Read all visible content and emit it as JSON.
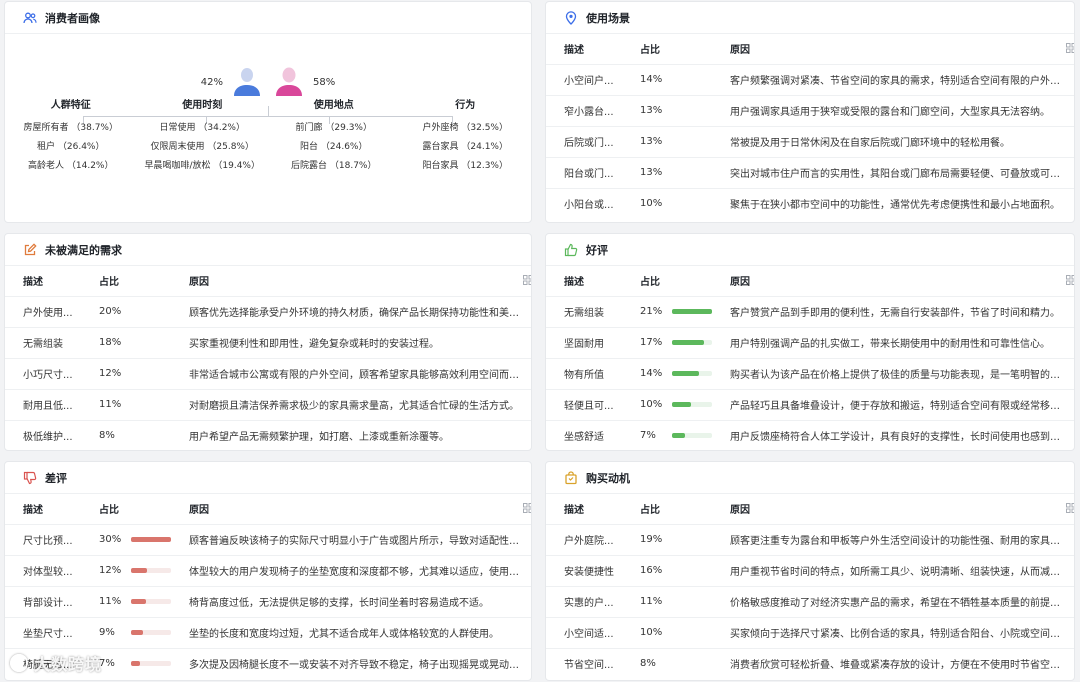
{
  "persona": {
    "title": "消费者画像",
    "male_pct": "42%",
    "female_pct": "58%",
    "groups": [
      {
        "title": "人群特征",
        "items": [
          "房屋所有者 （38.7%）",
          "租户 （26.4%）",
          "高龄老人 （14.2%）"
        ]
      },
      {
        "title": "使用时刻",
        "items": [
          "日常使用 （34.2%）",
          "仅限周末使用 （25.8%）",
          "早晨喝咖啡/放松 （19.4%）"
        ]
      },
      {
        "title": "使用地点",
        "items": [
          "前门廊 （29.3%）",
          "阳台 （24.6%）",
          "后院露台 （18.7%）"
        ]
      },
      {
        "title": "行为",
        "items": [
          "户外座椅 （32.5%）",
          "露台家具 （24.1%）",
          "阳台家具 （12.3%）"
        ]
      }
    ]
  },
  "headers": {
    "desc": "描述",
    "share": "占比",
    "reason": "原因"
  },
  "scenes": {
    "title": "使用场景",
    "rows": [
      {
        "desc": "小空间户...",
        "share": "14%",
        "reason": "客户频繁强调对紧凑、节省空间的家具的需求，特别适合空间有限的户外区..."
      },
      {
        "desc": "窄小露台...",
        "share": "13%",
        "reason": "用户强调家具适用于狭窄或受限的露台和门廊空间，大型家具无法容纳。"
      },
      {
        "desc": "后院或门...",
        "share": "13%",
        "reason": "常被提及用于日常休闲及在自家后院或门廊环境中的轻松用餐。"
      },
      {
        "desc": "阳台或门...",
        "share": "13%",
        "reason": "突出对城市住户而言的实用性，其阳台或门廊布局需要轻便、可叠放或可折..."
      },
      {
        "desc": "小阳台或...",
        "share": "10%",
        "reason": "聚焦于在狭小都市空间中的功能性，通常优先考虑便携性和最小占地面积。"
      }
    ]
  },
  "unmet": {
    "title": "未被满足的需求",
    "rows": [
      {
        "desc": "户外使用...",
        "share": "20%",
        "reason": "顾客优先选择能承受户外环境的持久材质，确保产品长期保持功能性和美观..."
      },
      {
        "desc": "无需组装",
        "share": "18%",
        "reason": "买家重视便利性和即用性，避免复杂或耗时的安装过程。"
      },
      {
        "desc": "小巧尺寸...",
        "share": "12%",
        "reason": "非常适合城市公寓或有限的户外空间，顾客希望家具能够高效利用空间而不..."
      },
      {
        "desc": "耐用且低...",
        "share": "11%",
        "reason": "对耐磨损且清洁保养需求极少的家具需求量高，尤其适合忙碌的生活方式。"
      },
      {
        "desc": "极低维护...",
        "share": "8%",
        "reason": "用户希望产品无需频繁护理，如打磨、上漆或重新涂覆等。"
      }
    ]
  },
  "praise": {
    "title": "好评",
    "color": "#5cb85c",
    "rows": [
      {
        "desc": "无需组装",
        "share": "21%",
        "value": 21,
        "reason": "客户赞赏产品到手即用的便利性，无需自行安装部件，节省了时间和精力。"
      },
      {
        "desc": "坚固耐用",
        "share": "17%",
        "value": 17,
        "reason": "用户特别强调产品的扎实做工，带来长期使用中的耐用性和可靠性信心。"
      },
      {
        "desc": "物有所值",
        "share": "14%",
        "value": 14,
        "reason": "购买者认为该产品在价格上提供了极佳的质量与功能表现，是一笔明智的购..."
      },
      {
        "desc": "轻便且可...",
        "share": "10%",
        "value": 10,
        "reason": "产品轻巧且具备堆叠设计，便于存放和搬运，特别适合空间有限或经常移动..."
      },
      {
        "desc": "坐感舒适",
        "share": "7%",
        "value": 7,
        "reason": "用户反馈座椅符合人体工学设计，具有良好的支撑性，长时间使用也感到舒..."
      }
    ]
  },
  "complaints": {
    "title": "差评",
    "color": "#d9756c",
    "rows": [
      {
        "desc": "尺寸比预...",
        "share": "30%",
        "value": 30,
        "reason": "顾客普遍反映该椅子的实际尺寸明显小于广告或图片所示，导致对适配性和..."
      },
      {
        "desc": "对体型较...",
        "share": "12%",
        "value": 12,
        "reason": "体型较大的用户发现椅子的坐垫宽度和深度都不够，尤其难以适应，使用起..."
      },
      {
        "desc": "背部设计...",
        "share": "11%",
        "value": 11,
        "reason": "椅背高度过低，无法提供足够的支撑，长时间坐着时容易造成不适。"
      },
      {
        "desc": "坐垫尺寸...",
        "share": "9%",
        "value": 9,
        "reason": "坐垫的长度和宽度均过短，尤其不适合成年人或体格较宽的人群使用。"
      },
      {
        "desc": "椅腿无法...",
        "share": "7%",
        "value": 7,
        "reason": "多次提及因椅腿长度不一或安装不对齐导致不稳定，椅子出现摇晃或晃动现..."
      }
    ]
  },
  "motivation": {
    "title": "购买动机",
    "rows": [
      {
        "desc": "户外庭院...",
        "share": "19%",
        "reason": "顾客更注重专为露台和甲板等户外生活空间设计的功能性强、耐用的家具，..."
      },
      {
        "desc": "安装便捷性",
        "share": "16%",
        "reason": "用户重视节省时间的特点，如所需工具少、说明清晰、组装快速，从而减少..."
      },
      {
        "desc": "实惠的户...",
        "share": "11%",
        "reason": "价格敏感度推动了对经济实惠产品的需求，希望在不牺牲基本质量的前提下..."
      },
      {
        "desc": "小空间适...",
        "share": "10%",
        "reason": "买家倾向于选择尺寸紧凑、比例合适的家具，特别适合阳台、小院或空间有..."
      },
      {
        "desc": "节省空间...",
        "share": "8%",
        "reason": "消费者欣赏可轻松折叠、堆叠或紧凑存放的设计，方便在不使用时节省空间。"
      }
    ]
  },
  "watermark": {
    "text": "大数跨境"
  },
  "colors": {
    "accent": "#3c6ee8",
    "male": "#4a7bdc",
    "female": "#d9479a"
  }
}
